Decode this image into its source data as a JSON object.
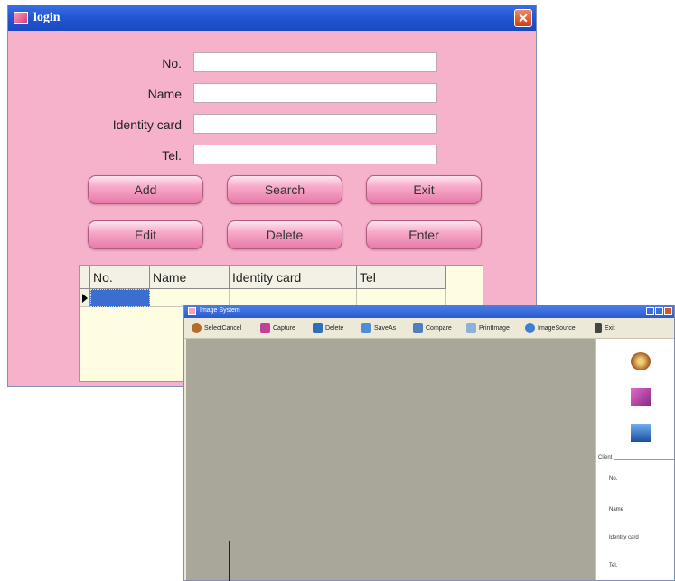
{
  "login": {
    "title": "login",
    "close_glyph": "✕",
    "fields": [
      {
        "label": "No.",
        "value": ""
      },
      {
        "label": "Name",
        "value": ""
      },
      {
        "label": "Identity card",
        "value": ""
      },
      {
        "label": "Tel.",
        "value": ""
      }
    ],
    "buttons_row1": [
      "Add",
      "Search",
      "Exit"
    ],
    "buttons_row2": [
      "Edit",
      "Delete",
      "Enter"
    ],
    "grid": {
      "columns": [
        "No.",
        "Name",
        "Identity card",
        "Tel"
      ]
    },
    "colors": {
      "background": "#f6b2cb",
      "titlebar": "#2357d4",
      "selected_cell": "#3a6ed0"
    }
  },
  "image_system": {
    "title": "Image System",
    "toolbar": [
      {
        "label": "SelectCancel",
        "icon": "film-reel-icon",
        "color": "#b56b2a"
      },
      {
        "label": "Capture",
        "icon": "camera-icon",
        "color": "#c0409a"
      },
      {
        "label": "Delete",
        "icon": "clapper-icon",
        "color": "#2d6fb8"
      },
      {
        "label": "SaveAs",
        "icon": "save-pen-icon",
        "color": "#4a8fd8"
      },
      {
        "label": "Compare",
        "icon": "compare-icon",
        "color": "#4f7fbf"
      },
      {
        "label": "PrintImage",
        "icon": "print-icon",
        "color": "#8fb0d8"
      },
      {
        "label": "ImageSource",
        "icon": "source-disc-icon",
        "color": "#3f7ed0"
      },
      {
        "label": "Exit",
        "icon": "exit-icon",
        "color": "#444444"
      }
    ],
    "side_icons": [
      "film-reel-icon",
      "camera-icon",
      "clapper-icon"
    ],
    "client": {
      "legend": "Client",
      "labels": [
        "No.",
        "Name",
        "Identity card",
        "Tel."
      ]
    },
    "colors": {
      "canvas": "#a9a69a",
      "frame": "#ece9d8"
    }
  }
}
